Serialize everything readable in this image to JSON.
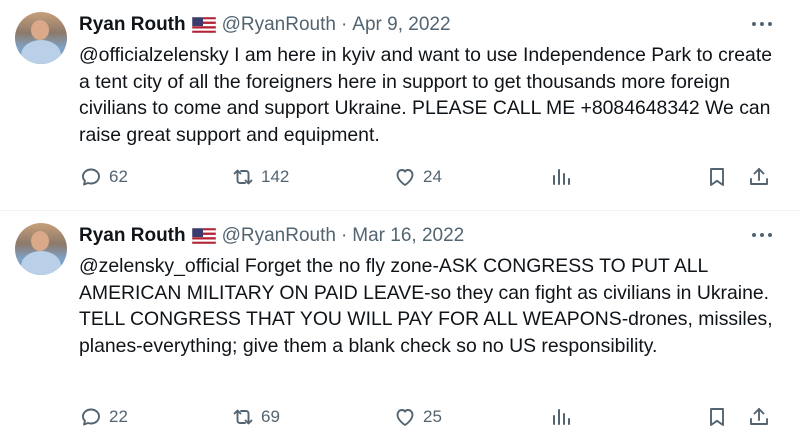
{
  "tweets": [
    {
      "name": "Ryan Routh",
      "handle": "@RyanRouth",
      "sep": "·",
      "date": "Apr 9, 2022",
      "text": "@officialzelensky I am here in kyiv and want to use Independence Park to create a tent city of all the foreigners here in support to get thousands more foreign civilians to come and support Ukraine. PLEASE CALL ME +8084648342 We can raise great support and equipment.",
      "replies": "62",
      "retweets": "142",
      "likes": "24"
    },
    {
      "name": "Ryan Routh",
      "handle": "@RyanRouth",
      "sep": "·",
      "date": "Mar 16, 2022",
      "text": "@zelensky_official Forget the no fly zone-ASK CONGRESS TO PUT ALL AMERICAN MILITARY ON PAID LEAVE-so they can fight as civilians in Ukraine.  TELL CONGRESS THAT YOU WILL PAY FOR ALL WEAPONS-drones, missiles, planes-everything; give them a blank check so no US responsibility.",
      "replies": "22",
      "retweets": "69",
      "likes": "25"
    }
  ],
  "icons": {
    "more": "more-dots-icon",
    "reply": "reply-icon",
    "retweet": "retweet-icon",
    "like": "heart-icon",
    "views": "views-icon",
    "bookmark": "bookmark-icon",
    "share": "share-icon",
    "flag": "us-flag-icon"
  },
  "colors": {
    "text": "#0f1419",
    "secondary": "#536471",
    "divider": "#eff3f4"
  }
}
